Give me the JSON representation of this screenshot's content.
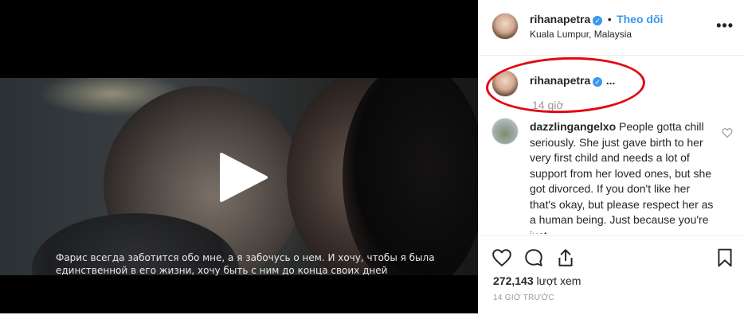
{
  "video": {
    "subtitle_line1": "Фарис всегда заботится обо мне, а я забочусь о нем. И хочу, чтобы я была",
    "subtitle_line2": "единственной в его жизни, хочу быть с ним до конца своих дней"
  },
  "header": {
    "username": "rihanapetra",
    "separator": "•",
    "follow_label": "Theo dõi",
    "location": "Kuala Lumpur, Malaysia",
    "more_label": "•••"
  },
  "caption": {
    "username": "rihanapetra",
    "ellipsis": "...",
    "time": "14 giờ"
  },
  "comment": {
    "username": "dazzlingangelxo",
    "text": "People gotta chill seriously. She just gave birth to her very first child and needs a lot of support from her loved ones, but she got divorced. If you don't like her that's okay, but please respect her as a human being. Just because you're just"
  },
  "stats": {
    "views_count": "272,143",
    "views_label": "lượt xem",
    "post_time": "14 GIỜ TRƯỚC"
  },
  "icons": {
    "verified": "verified-badge-icon",
    "like": "heart-icon",
    "comment": "comment-bubble-icon",
    "share": "share-icon",
    "save": "bookmark-icon",
    "play": "play-icon"
  },
  "colors": {
    "accent": "#3897f0",
    "annotation": "#e30613"
  }
}
